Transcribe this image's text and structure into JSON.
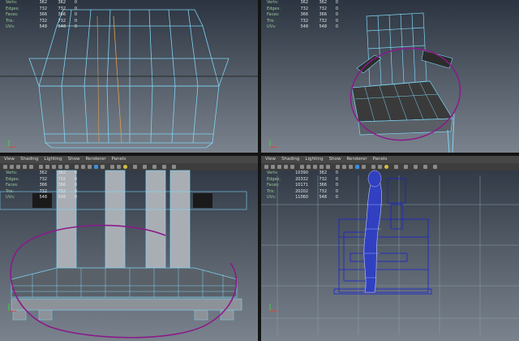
{
  "hud": {
    "labels": [
      "Verts:",
      "Edges:",
      "Faces:",
      "Tris:",
      "UVs:"
    ],
    "col1": [
      "362",
      "732",
      "366",
      "732",
      "548"
    ],
    "col2": [
      "362",
      "732",
      "366",
      "732",
      "548"
    ],
    "col3": [
      "0",
      "0",
      "0",
      "0",
      "0"
    ]
  },
  "hud_right_bottom": {
    "col1": [
      "10390",
      "20332",
      "10171",
      "20202",
      "11060"
    ],
    "col2": [
      "362",
      "732",
      "366",
      "732",
      "548"
    ],
    "col3": [
      "0",
      "0",
      "0",
      "0",
      "0"
    ]
  },
  "menu": [
    "View",
    "Shading",
    "Lighting",
    "Show",
    "Renderer",
    "Panels"
  ],
  "colors": {
    "wire": "#7fd4f5",
    "annotation": "#8b1a8b",
    "scene_blue": "#1a22d0"
  },
  "icons": [
    "axis-gizmo-icon",
    "toolbar-icon"
  ]
}
